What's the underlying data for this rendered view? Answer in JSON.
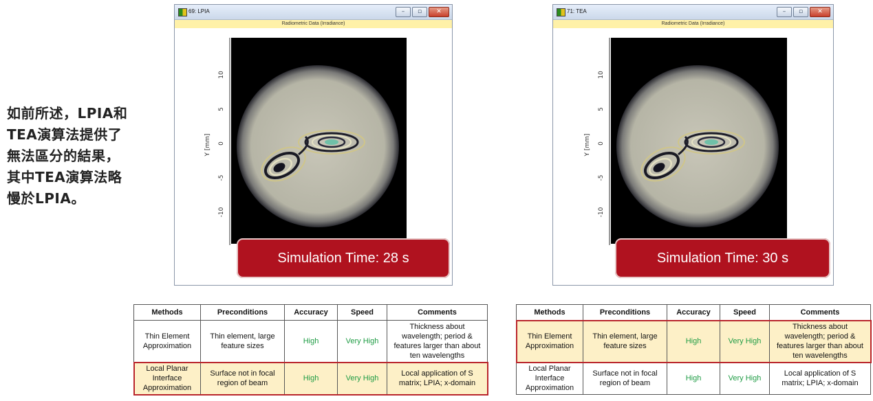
{
  "description": "如前所述，LPIA和\nTEA演算法提供了\n無法區分的結果，\n其中TEA演算法略\n慢於LPIA。",
  "windows": [
    {
      "title": "69: LPIA",
      "subtitle": "Radiometric Data (Irradiance)",
      "sim_label": "Simulation Time: 28 s",
      "y_axis_label": "Y [mm]",
      "y_ticks": [
        "10",
        "5",
        "0",
        "-5",
        "-10"
      ]
    },
    {
      "title": "71: TEA",
      "subtitle": "Radiometric Data (Irradiance)",
      "sim_label": "Simulation Time: 30 s",
      "y_axis_label": "Y [mm]",
      "y_ticks": [
        "10",
        "5",
        "0",
        "-5",
        "-10"
      ]
    }
  ],
  "window_buttons": {
    "minimize": "–",
    "restore": "▫",
    "close": "✕"
  },
  "tables": [
    {
      "headers": [
        "Methods",
        "Preconditions",
        "Accuracy",
        "Speed",
        "Comments"
      ],
      "rows": [
        [
          "Thin Element Approximation",
          "Thin element, large feature sizes",
          "High",
          "Very High",
          "Thickness about wavelength; period & features larger than about ten wavelengths"
        ],
        [
          "Local Planar Interface Approximation",
          "Surface not in focal region of beam",
          "High",
          "Very High",
          "Local application of S matrix; LPIA; x-domain"
        ]
      ]
    },
    {
      "headers": [
        "Methods",
        "Preconditions",
        "Accuracy",
        "Speed",
        "Comments"
      ],
      "rows": [
        [
          "Thin Element Approximation",
          "Thin element, large feature sizes",
          "High",
          "Very High",
          "Thickness about wavelength; period & features larger than about ten wavelengths"
        ],
        [
          "Local Planar Interface Approximation",
          "Surface not in focal region of beam",
          "High",
          "Very High",
          "Local application of S matrix; LPIA; x-domain"
        ]
      ]
    }
  ],
  "colors": {
    "sim_box": "#b0121f",
    "highlight": "#fdf0c7",
    "highlight_border": "#b9242b",
    "green_text": "#1f9c45"
  }
}
